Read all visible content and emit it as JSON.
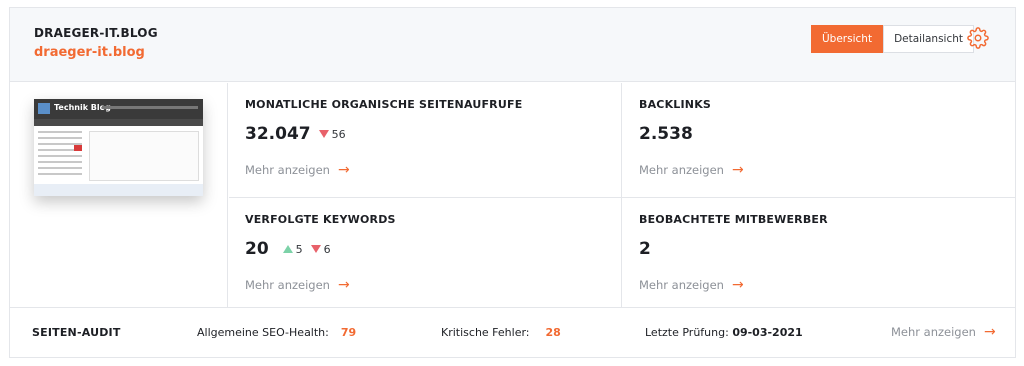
{
  "header": {
    "site_name": "DRAEGER-IT.BLOG",
    "site_link": "draeger-it.blog",
    "view_toggle": {
      "overview_label": "Übersicht",
      "detail_label": "Detailansicht",
      "active": "overview"
    },
    "settings_icon": "gear-icon"
  },
  "thumbnail": {
    "title": "Technik Blog"
  },
  "stats": {
    "organic_visits": {
      "title": "MONATLICHE ORGANISCHE SEITENAUFRUFE",
      "value": "32.047",
      "down": "56",
      "more": "Mehr anzeigen"
    },
    "backlinks": {
      "title": "BACKLINKS",
      "value": "2.538",
      "more": "Mehr anzeigen"
    },
    "keywords": {
      "title": "VERFOLGTE KEYWORDS",
      "value": "20",
      "up": "5",
      "down": "6",
      "more": "Mehr anzeigen"
    },
    "competitors": {
      "title": "BEOBACHTETE MITBEWERBER",
      "value": "2",
      "more": "Mehr anzeigen"
    }
  },
  "audit": {
    "title": "SEITEN-AUDIT",
    "health_label": "Allgemeine SEO-Health:",
    "health_value": "79",
    "errors_label": "Kritische Fehler:",
    "errors_value": "28",
    "last_check_label": "Letzte Prüfung:",
    "last_check_value": "09-03-2021",
    "more": "Mehr anzeigen"
  },
  "colors": {
    "accent": "#f26a32",
    "down": "#e8616a",
    "up": "#7cd2a8",
    "muted": "#8d9198"
  }
}
